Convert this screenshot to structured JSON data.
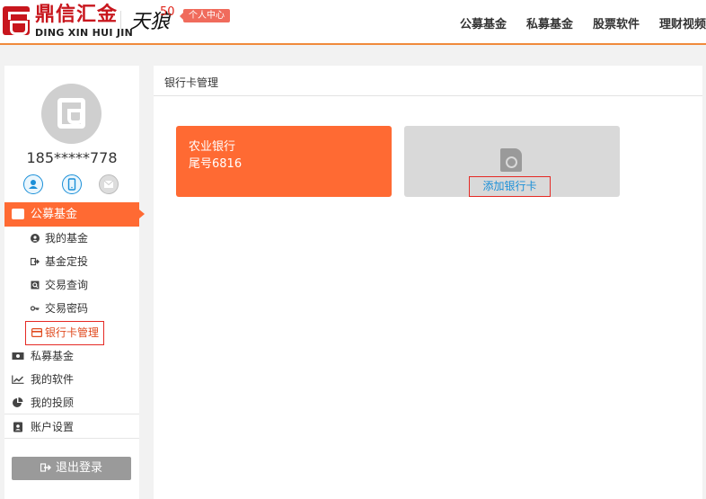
{
  "header": {
    "logo_cn": "鼎信汇金",
    "logo_en": "DING XIN HUI JIN",
    "brand2": "天狼",
    "brand2_num": "50",
    "user_center": "个人中心",
    "nav": [
      "公募基金",
      "私募基金",
      "股票软件",
      "理财视频"
    ]
  },
  "sidebar": {
    "phone": "185*****778",
    "active_menu": "公募基金",
    "sub_items": [
      "我的基金",
      "基金定投",
      "交易查询",
      "交易密码",
      "银行卡管理"
    ],
    "items": [
      "私募基金",
      "我的软件",
      "我的投顾",
      "账户设置"
    ],
    "logout": "退出登录"
  },
  "main": {
    "title": "银行卡管理",
    "card": {
      "bank": "农业银行",
      "tail": "尾号6816"
    },
    "add_card": "添加银行卡"
  },
  "colors": {
    "accent": "#ff6a33",
    "brand_red": "#c8161d",
    "link": "#1a8fd8",
    "highlight_border": "#e52a25"
  }
}
